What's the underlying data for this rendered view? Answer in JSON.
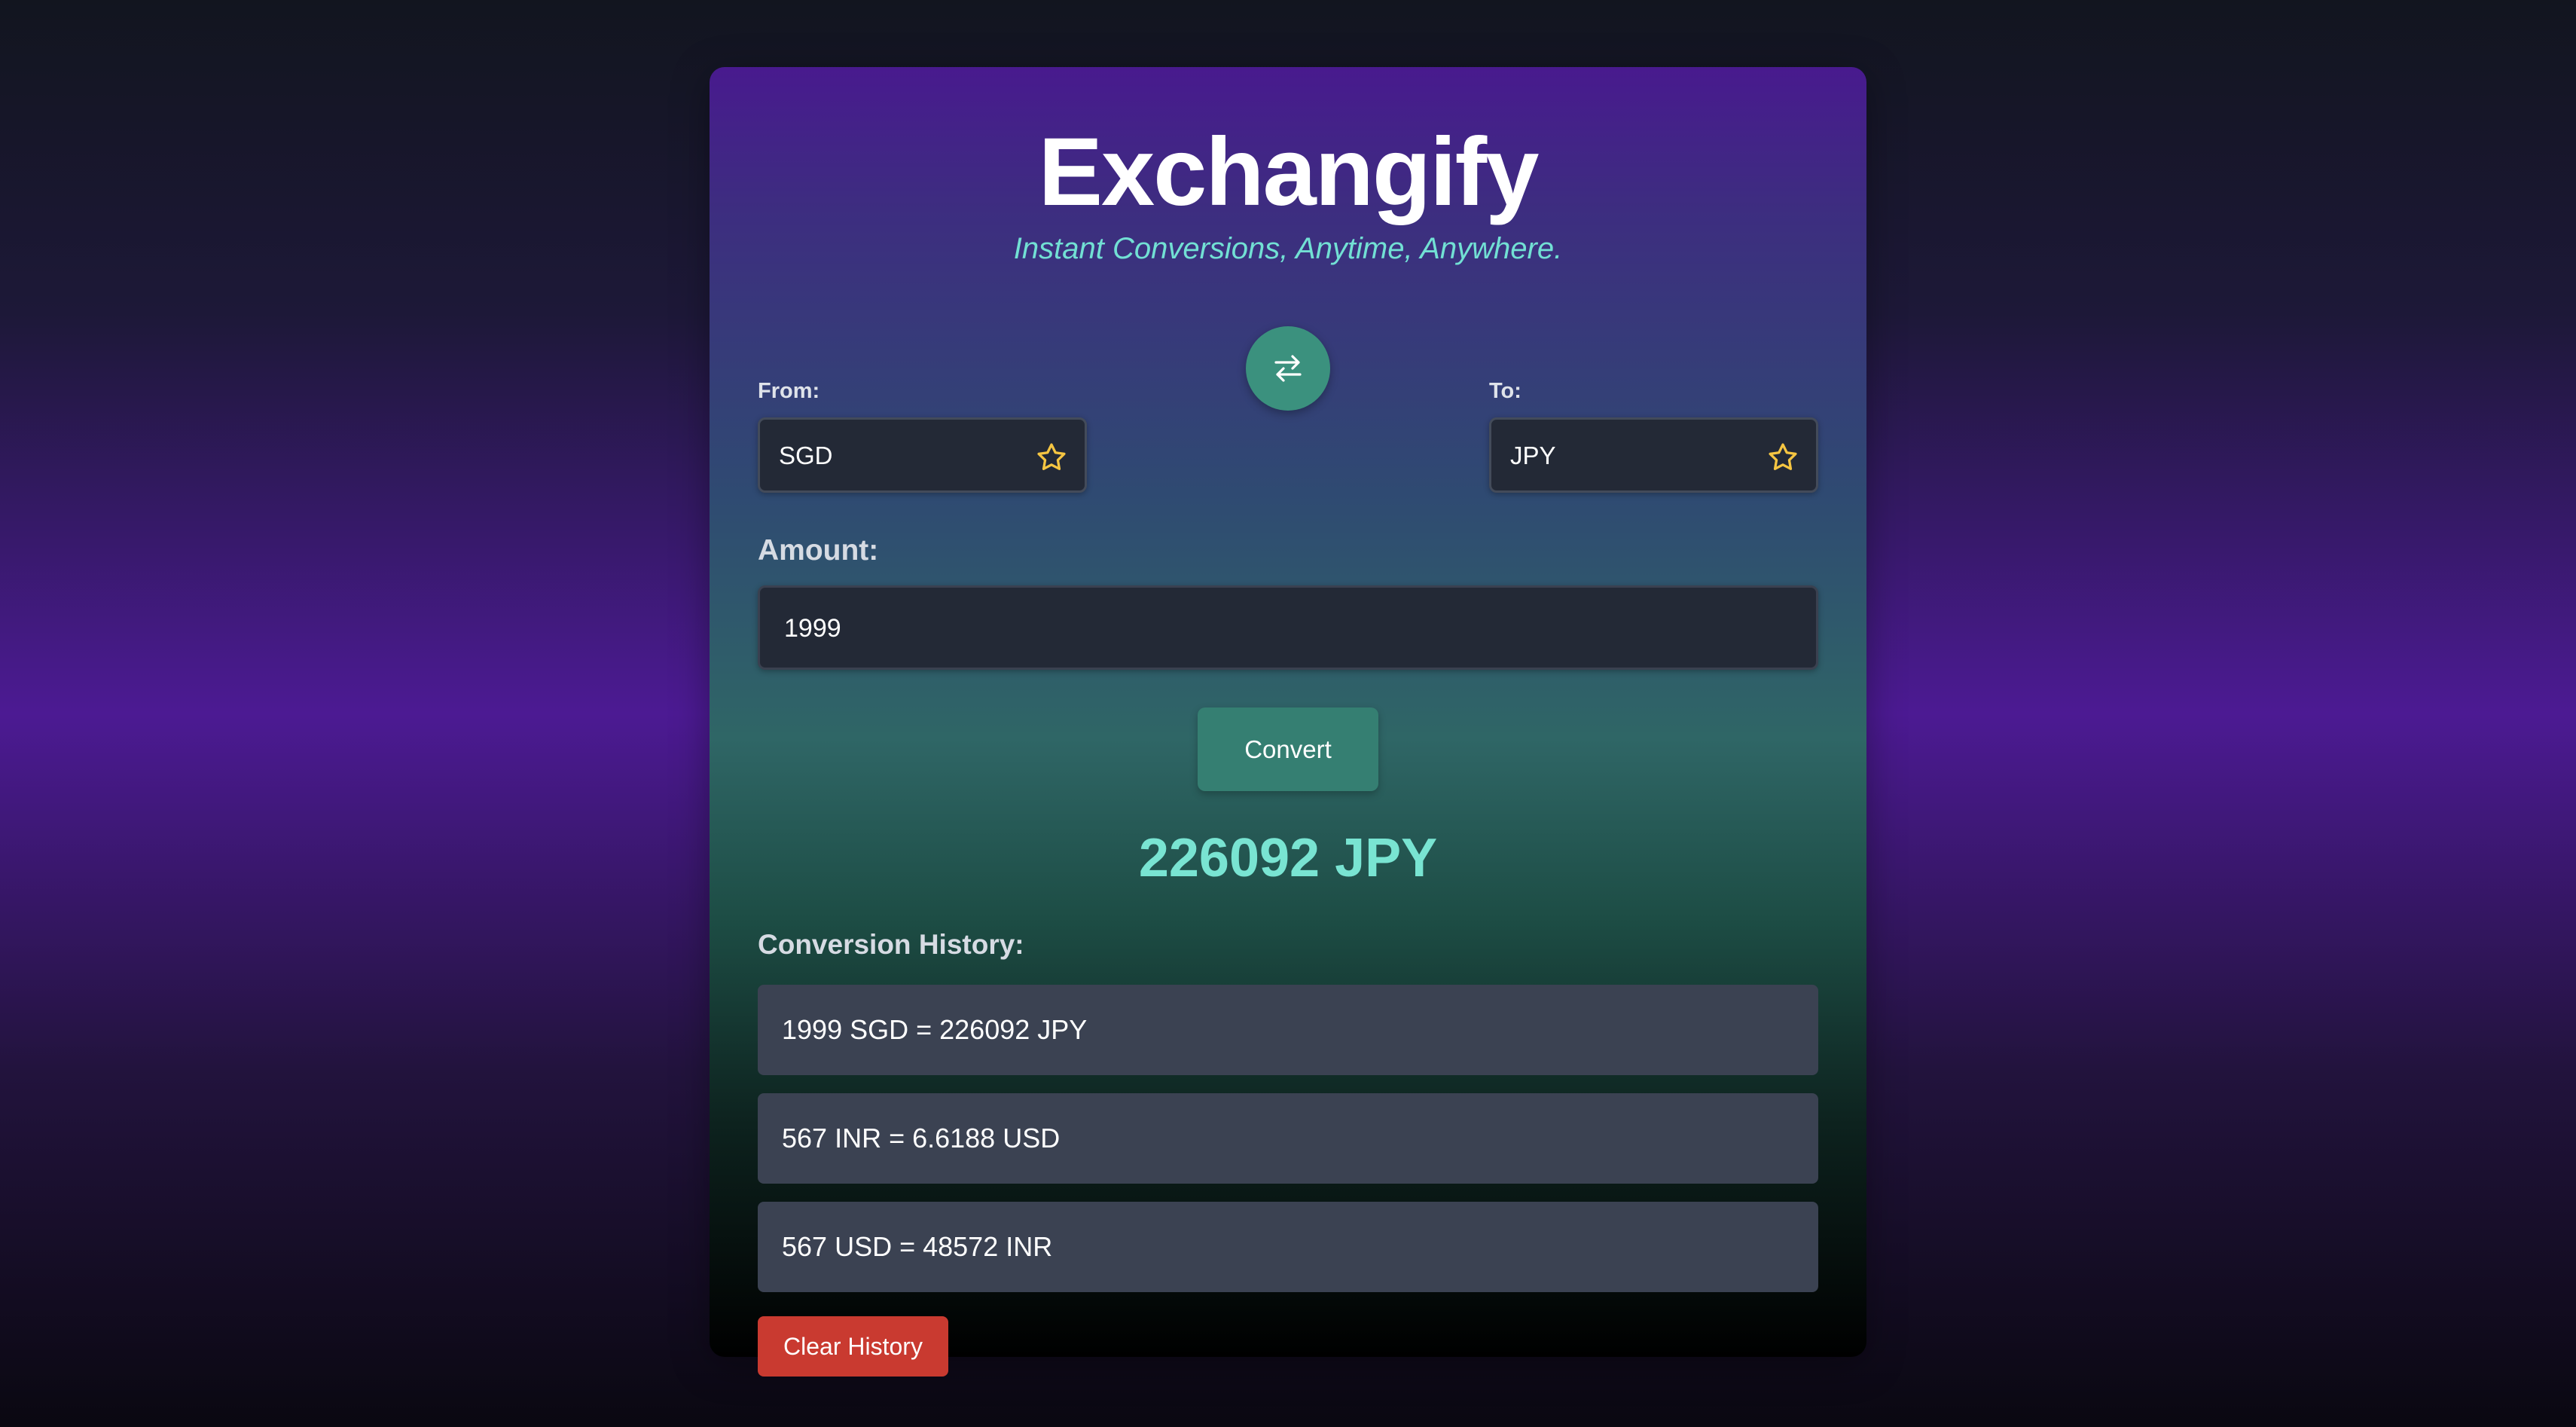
{
  "app": {
    "title": "Exchangify",
    "tagline": "Instant Conversions, Anytime, Anywhere."
  },
  "from": {
    "label": "From:",
    "currency": "SGD",
    "favorite_icon": "star-outline-icon"
  },
  "to": {
    "label": "To:",
    "currency": "JPY",
    "favorite_icon": "star-outline-icon"
  },
  "swap": {
    "icon": "swap-arrows-icon"
  },
  "amount": {
    "label": "Amount:",
    "value": "1999"
  },
  "convert": {
    "label": "Convert"
  },
  "result": {
    "text": "226092 JPY"
  },
  "history": {
    "label": "Conversion History:",
    "items": [
      "1999 SGD = 226092 JPY",
      "567 INR = 6.6188 USD",
      "567 USD = 48572 INR"
    ],
    "clear_label": "Clear History"
  },
  "colors": {
    "accent_teal": "#3b917e",
    "result_text": "#79e4d2",
    "tagline_text": "#72e0d4",
    "star": "#f5c542",
    "danger": "#c93a30"
  }
}
